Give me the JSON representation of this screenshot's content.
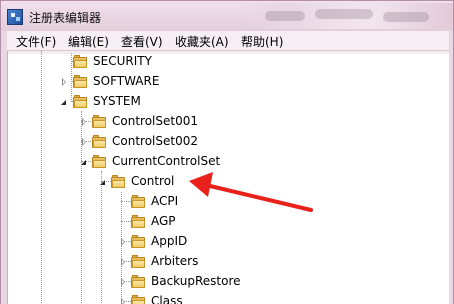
{
  "window": {
    "title": "注册表编辑器",
    "accent": "#e9d7e3"
  },
  "menu": {
    "items": [
      "文件(F)",
      "编辑(E)",
      "查看(V)",
      "收藏夹(A)",
      "帮助(H)"
    ]
  },
  "tree": {
    "nodes": [
      {
        "label": "SECURITY",
        "state": "collapsed"
      },
      {
        "label": "SOFTWARE",
        "state": "collapsed"
      },
      {
        "label": "SYSTEM",
        "state": "expanded"
      },
      {
        "label": "ControlSet001",
        "state": "collapsed"
      },
      {
        "label": "ControlSet002",
        "state": "collapsed"
      },
      {
        "label": "CurrentControlSet",
        "state": "expanded"
      },
      {
        "label": "Control",
        "state": "expanded"
      },
      {
        "label": "ACPI",
        "state": "leaf"
      },
      {
        "label": "AGP",
        "state": "leaf"
      },
      {
        "label": "AppID",
        "state": "collapsed"
      },
      {
        "label": "Arbiters",
        "state": "collapsed"
      },
      {
        "label": "BackupRestore",
        "state": "collapsed"
      },
      {
        "label": "Class",
        "state": "collapsed"
      }
    ]
  },
  "annotation": {
    "arrow_color": "#e8221b",
    "points_to": "Control"
  },
  "icons": {
    "app": "registry-editor-icon",
    "folder": "folder-icon",
    "expand": "chevron-down-icon",
    "collapse": "chevron-right-icon"
  }
}
